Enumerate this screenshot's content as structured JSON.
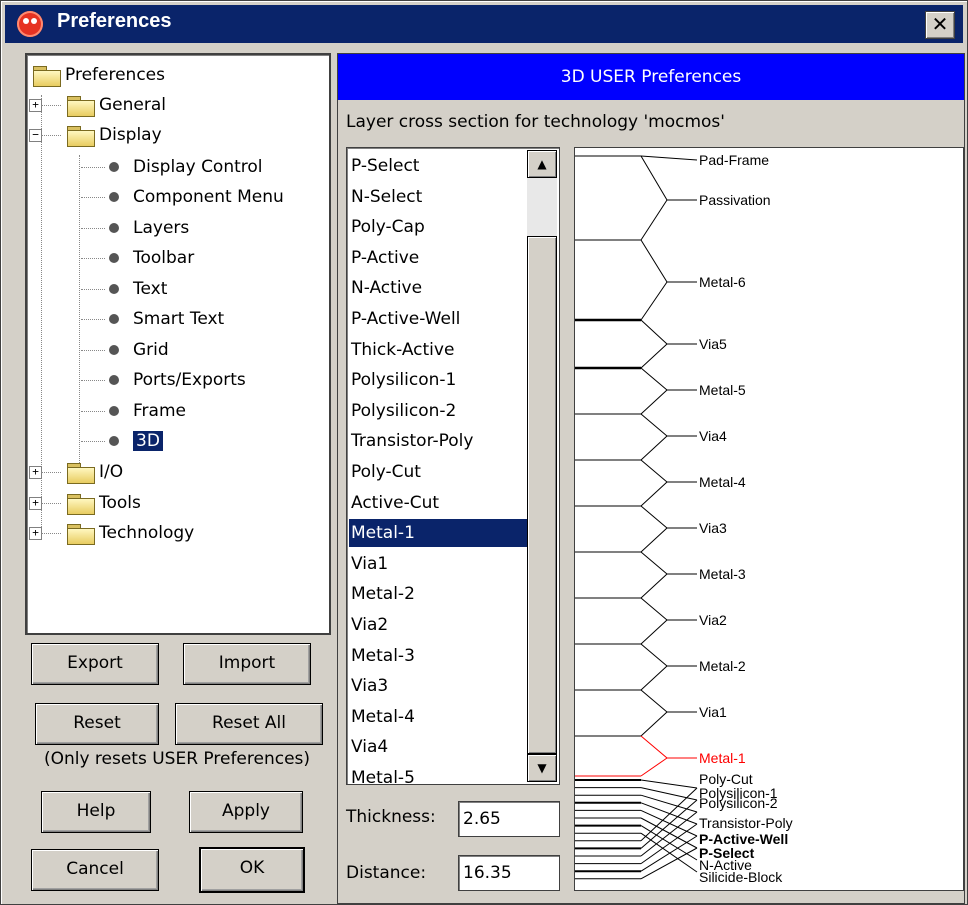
{
  "window": {
    "title": "Preferences",
    "close_glyph": "✕",
    "app_icon": "electric-app-icon"
  },
  "tree": {
    "root": "Preferences",
    "items": [
      {
        "label": "General",
        "expander": "+"
      },
      {
        "label": "Display",
        "expander": "−"
      },
      {
        "label": "Display Control"
      },
      {
        "label": "Component Menu"
      },
      {
        "label": "Layers"
      },
      {
        "label": "Toolbar"
      },
      {
        "label": "Text"
      },
      {
        "label": "Smart Text"
      },
      {
        "label": "Grid"
      },
      {
        "label": "Ports/Exports"
      },
      {
        "label": "Frame"
      },
      {
        "label": "3D"
      },
      {
        "label": "I/O",
        "expander": "+"
      },
      {
        "label": "Tools",
        "expander": "+"
      },
      {
        "label": "Technology",
        "expander": "+"
      }
    ],
    "selected": "3D"
  },
  "buttons": {
    "export": "Export",
    "import": "Import",
    "reset": "Reset",
    "reset_all": "Reset All",
    "note": "(Only resets USER Preferences)",
    "help": "Help",
    "apply": "Apply",
    "cancel": "Cancel",
    "ok": "OK"
  },
  "panel": {
    "header": "3D USER Preferences",
    "subtitle": "Layer cross section for technology 'mocmos'"
  },
  "layer_list": {
    "items": [
      "P-Select",
      "N-Select",
      "Poly-Cap",
      "P-Active",
      "N-Active",
      "P-Active-Well",
      "Thick-Active",
      "Polysilicon-1",
      "Polysilicon-2",
      "Transistor-Poly",
      "Poly-Cut",
      "Active-Cut",
      "Metal-1",
      "Via1",
      "Metal-2",
      "Via2",
      "Metal-3",
      "Via3",
      "Metal-4",
      "Via4",
      "Metal-5"
    ],
    "selected": "Metal-1",
    "scroll_up": "▲",
    "scroll_down": "▼"
  },
  "fields": {
    "thickness_label": "Thickness:",
    "thickness_value": "2.65",
    "distance_label": "Distance:",
    "distance_value": "16.35"
  },
  "cross_section": {
    "highlight_color": "#ff0000",
    "labels": [
      "Pad-Frame",
      "Passivation",
      "Metal-6",
      "Via5",
      "Metal-5",
      "Via4",
      "Metal-4",
      "Via3",
      "Metal-3",
      "Via2",
      "Metal-2",
      "Via1",
      "Metal-1"
    ],
    "bottom_labels": [
      "Poly-Cut",
      "Polysilicon-1",
      "Polysilicon-2",
      "Transistor-Poly",
      "P-Active-Well",
      "P-Select",
      "N-Active",
      "Silicide-Block"
    ],
    "highlighted": "Metal-1"
  }
}
